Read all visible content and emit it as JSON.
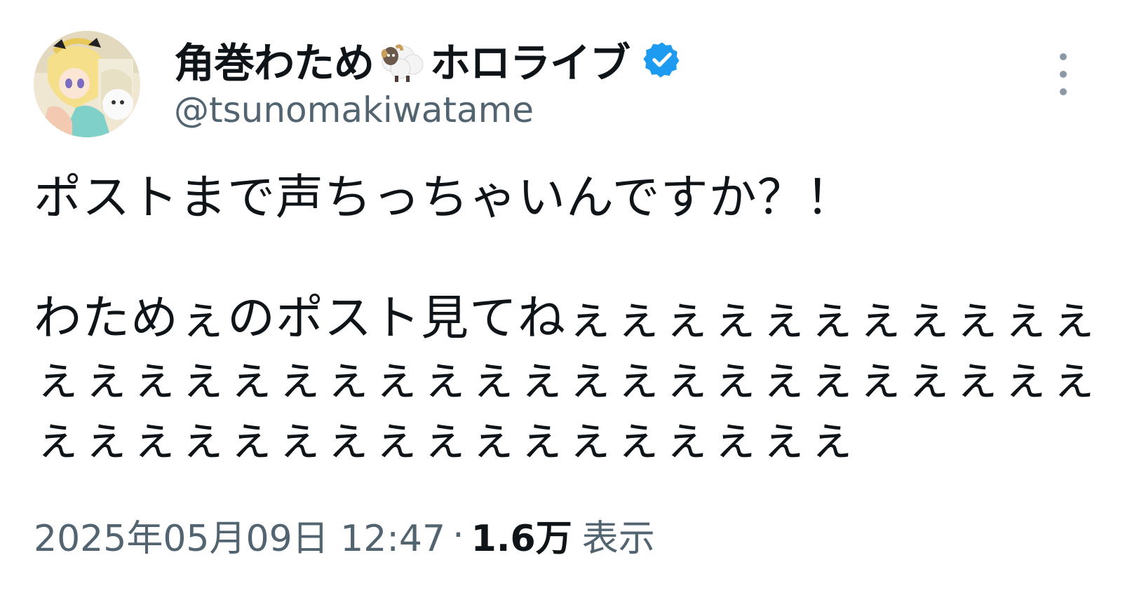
{
  "author": {
    "display_name": "角巻わため",
    "display_name_suffix": "ホロライブ",
    "name_emoji": "sheep-icon",
    "handle": "@tsunomakiwatame",
    "verified": true,
    "verified_color": "#1d9bf0"
  },
  "post": {
    "line1": "ポストまで声ちっちゃいんですか？！",
    "line2": "わためぇのポスト見てねぇぇぇぇぇぇぇぇぇぇぇぇぇぇぇぇぇぇぇぇぇぇぇぇぇぇぇぇぇぇぇぇぇぇぇぇぇぇぇぇぇぇぇぇぇぇぇぇぇぇ"
  },
  "meta": {
    "timestamp": "2025年05月09日 12:47",
    "separator": "·",
    "views_count": "1.6万",
    "views_label": "表示"
  },
  "icons": {
    "more": "more-vertical-icon",
    "verified": "verified-badge-icon"
  },
  "colors": {
    "text_primary": "#0f1419",
    "text_secondary": "#536471",
    "accent": "#1d9bf0"
  }
}
